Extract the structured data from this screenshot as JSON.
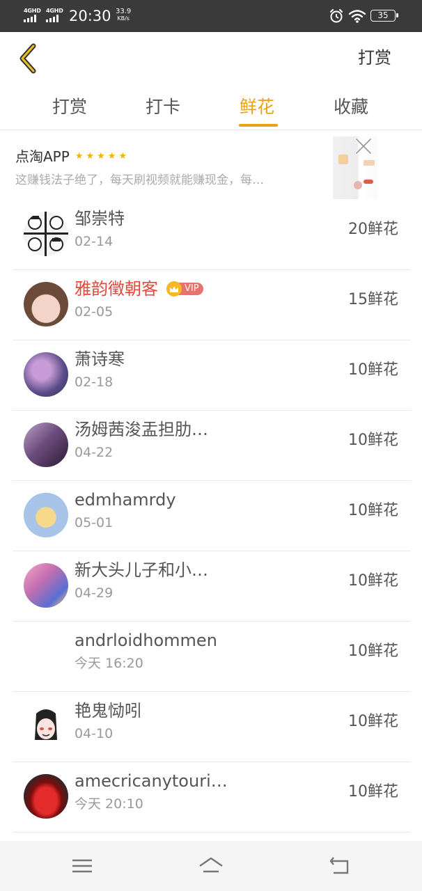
{
  "status_bar": {
    "network_1": "4GHD",
    "network_2": "4GHD",
    "time": "20:30",
    "speed_value": "33.9",
    "speed_unit": "KB/s",
    "battery": "35"
  },
  "header": {
    "back_icon": "chevron-left-icon",
    "action_label": "打赏"
  },
  "tabs": [
    {
      "label": "打赏",
      "active": false
    },
    {
      "label": "打卡",
      "active": false
    },
    {
      "label": "鲜花",
      "active": true
    },
    {
      "label": "收藏",
      "active": false
    }
  ],
  "accent_color": "#e8a317",
  "ad": {
    "title": "点淘APP",
    "rating_stars": 5,
    "description": "这赚钱法子绝了，每天刷视频就能赚现金，每…"
  },
  "list": [
    {
      "name": "邹崇特",
      "date": "02-14",
      "flowers": "20鲜花",
      "vip": false
    },
    {
      "name": "雅韵徵朝客",
      "date": "02-05",
      "flowers": "15鲜花",
      "vip": true,
      "vip_label": "VIP"
    },
    {
      "name": "萧诗寒",
      "date": "02-18",
      "flowers": "10鲜花",
      "vip": false
    },
    {
      "name": "汤姆茜浚盂担肋…",
      "date": "04-22",
      "flowers": "10鲜花",
      "vip": false
    },
    {
      "name": "edmhamrdy",
      "date": "05-01",
      "flowers": "10鲜花",
      "vip": false
    },
    {
      "name": "新大头儿子和小…",
      "date": "04-29",
      "flowers": "10鲜花",
      "vip": false
    },
    {
      "name": "andrloidhommen",
      "date": "今天 16:20",
      "flowers": "10鲜花",
      "vip": false
    },
    {
      "name": "艳鬼恸吲",
      "date": "04-10",
      "flowers": "10鲜花",
      "vip": false
    },
    {
      "name": "amecricanytouri…",
      "date": "今天 20:10",
      "flowers": "10鲜花",
      "vip": false
    }
  ]
}
